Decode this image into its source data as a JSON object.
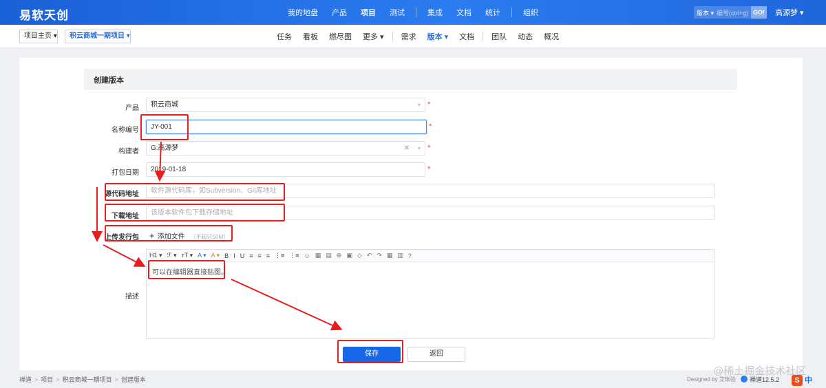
{
  "brand": "易软天创",
  "main_nav": [
    {
      "label": "我的地盘"
    },
    {
      "label": "产品"
    },
    {
      "label": "项目",
      "active": true
    },
    {
      "label": "测试"
    },
    {
      "sep": true
    },
    {
      "label": "集成"
    },
    {
      "label": "文档"
    },
    {
      "label": "统计"
    },
    {
      "sep": true
    },
    {
      "label": "组织"
    }
  ],
  "search": {
    "type_label": "版本 ▾",
    "placeholder": "编号(ctrl+g)",
    "go_label": "GO!"
  },
  "user": "高源梦 ▾",
  "sub": {
    "home_label": "项目主页 ▾",
    "project_label": "积云商城一期项目 ▾",
    "nav": [
      {
        "label": "任务"
      },
      {
        "label": "看板"
      },
      {
        "label": "燃尽图"
      },
      {
        "label": "更多 ▾"
      },
      {
        "sep": true
      },
      {
        "label": "需求"
      },
      {
        "label": "版本 ▾",
        "active": true
      },
      {
        "label": "文档"
      },
      {
        "sep": true
      },
      {
        "label": "团队"
      },
      {
        "label": "动态"
      },
      {
        "label": "概况"
      }
    ]
  },
  "form": {
    "title": "创建版本",
    "product_label": "产品",
    "product_value": "积云商城",
    "name_label": "名称编号",
    "name_value": "JY-001",
    "builder_label": "构建者",
    "builder_value": "G:高源梦",
    "date_label": "打包日期",
    "date_value": "2019-01-18",
    "source_label": "源代码地址",
    "source_placeholder": "软件源代码库，如Subversion、Git库地址",
    "download_label": "下载地址",
    "download_placeholder": "该版本软件包下载存储地址",
    "upload_label": "上传发行包",
    "upload_action": "添加文件",
    "upload_limit": "（不超过50M）",
    "desc_label": "描述",
    "editor_hint": "可以在编辑器直接贴图。",
    "required_mark": "*",
    "save_label": "保存",
    "back_label": "返回"
  },
  "toolbar": [
    "H1 ▾",
    "ℱ ▾",
    "ᴛT ▾",
    "A ▾",
    "A ▾",
    "B",
    "I",
    "U",
    "≡",
    "≡",
    "≡",
    "⋮≡",
    "⋮≡",
    "☺",
    "▦",
    "▤",
    "⊕",
    "▣",
    "◇",
    "↶",
    "↷",
    "▦",
    "▥",
    "?"
  ],
  "footer": {
    "crumbs": [
      "禅道",
      "项目",
      "积云商城一期项目",
      "创建版本"
    ],
    "designed_by": "Designed by 艾体验",
    "version": "禅道12.5.2"
  },
  "watermark": "@稀土掘金技术社区",
  "ime": {
    "logo": "S",
    "mode": "中"
  },
  "colors": {
    "primary": "#1668e8",
    "annotation": "#e61e1e",
    "topbar": "#2b7cf0"
  }
}
